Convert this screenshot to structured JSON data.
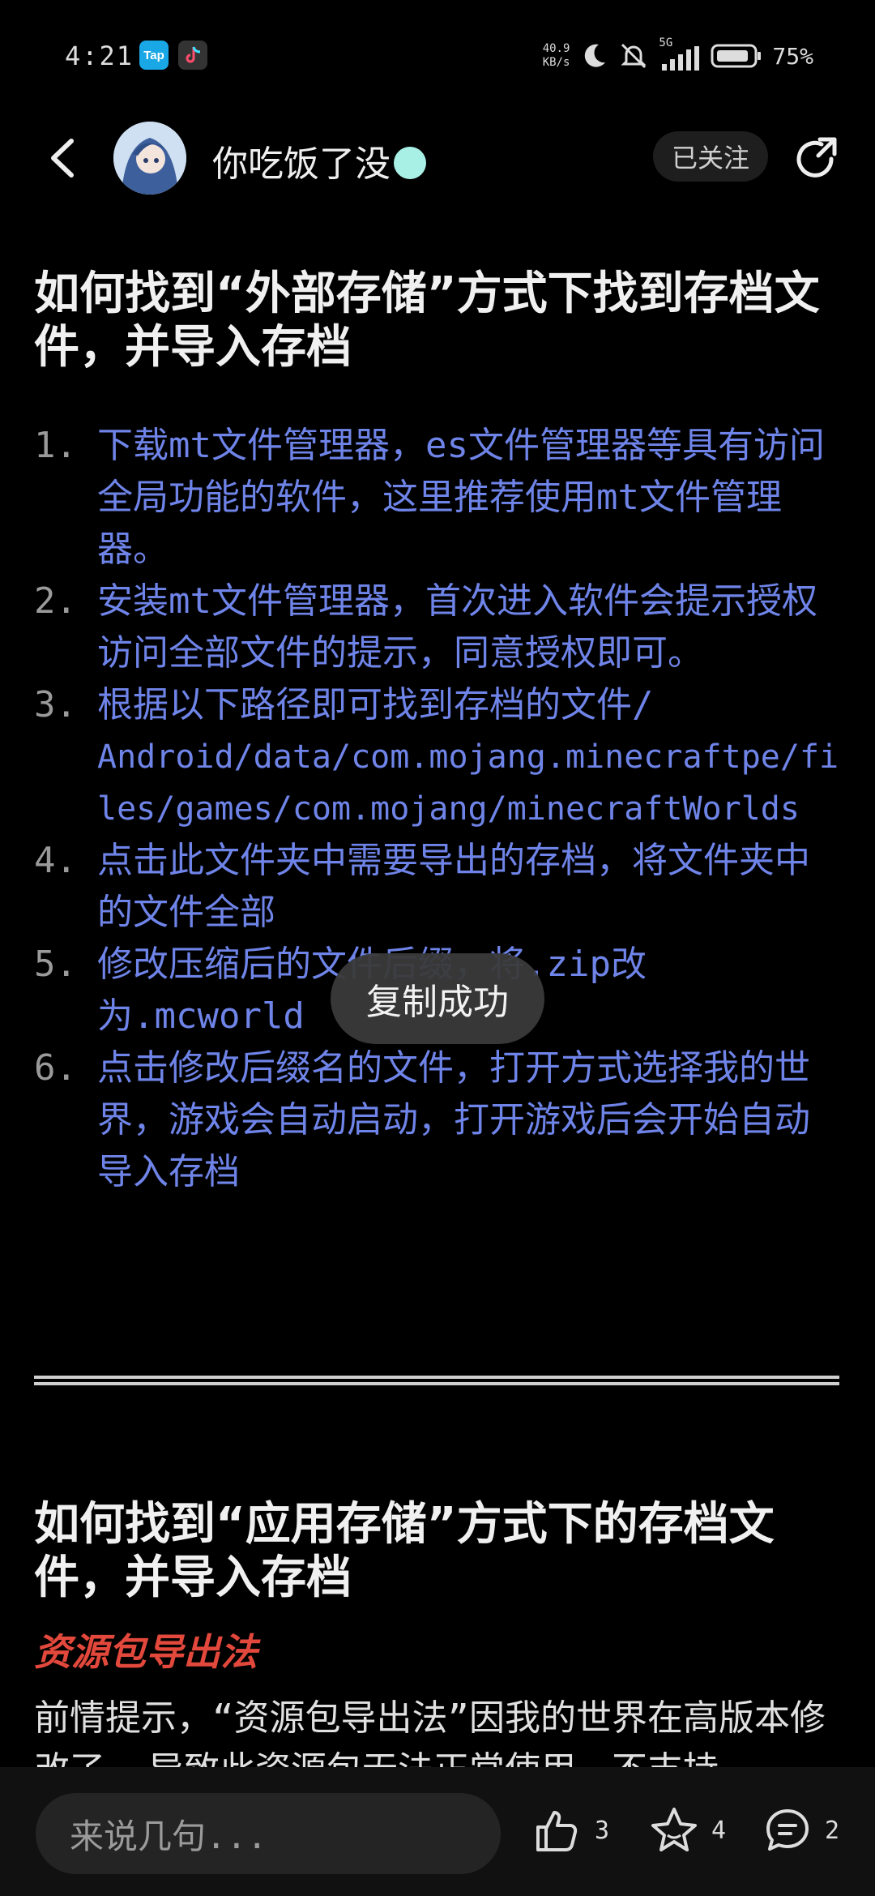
{
  "status_bar": {
    "time": "4:21",
    "tap_label": "Tap",
    "net_speed_value": "40.9",
    "net_speed_unit": "KB/s",
    "network": "5G",
    "battery": "75%"
  },
  "header": {
    "username": "你吃饭了没",
    "follow_label": "已关注"
  },
  "article": {
    "title1": "如何找到“外部存储”方式下找到存档文件，并导入存档",
    "steps": [
      {
        "num": "1.",
        "text": "下载mt文件管理器，es文件管理器等具有访问全局功能的软件，这里推荐使用mt文件管理器。"
      },
      {
        "num": "2.",
        "text": "安装mt文件管理器，首次进入软件会提示授权访问全部文件的提示，同意授权即可。"
      },
      {
        "num": "3.",
        "text": "根据以下路径即可找到存档的文件/",
        "path": "Android/data/com.mojang.minecraftpe/files/games/com.mojang/minecraftWorlds"
      },
      {
        "num": "4.",
        "text": "点击此文件夹中需要导出的存档，将文件夹中的文件全部"
      },
      {
        "num": "5.",
        "text": "修改压缩后的文件后缀，将.zip改为.mcworld"
      },
      {
        "num": "6.",
        "text": "点击修改后缀名的文件，打开方式选择我的世界，游戏会自动启动，打开游戏后会开始自动导入存档"
      }
    ],
    "title2": "如何找到“应用存储”方式下的存档文件，并导入存档",
    "subheading": "资源包导出法",
    "paragraph": "前情提示，“资源包导出法”因我的世界在高版本修改了……导致此资源包无法正常使用，不支持"
  },
  "toast": "复制成功",
  "bottom_bar": {
    "comment_placeholder": "来说几句...",
    "like_count": "3",
    "favorite_count": "4",
    "comment_count": "2"
  }
}
